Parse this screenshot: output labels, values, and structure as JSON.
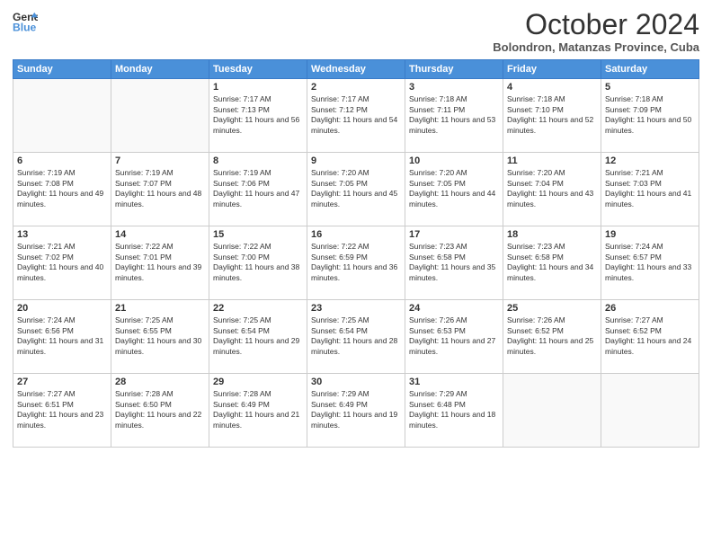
{
  "logo": {
    "line1": "General",
    "line2": "Blue"
  },
  "title": "October 2024",
  "subtitle": "Bolondron, Matanzas Province, Cuba",
  "days_of_week": [
    "Sunday",
    "Monday",
    "Tuesday",
    "Wednesday",
    "Thursday",
    "Friday",
    "Saturday"
  ],
  "weeks": [
    [
      {
        "day": "",
        "sunrise": "",
        "sunset": "",
        "daylight": ""
      },
      {
        "day": "",
        "sunrise": "",
        "sunset": "",
        "daylight": ""
      },
      {
        "day": "1",
        "sunrise": "Sunrise: 7:17 AM",
        "sunset": "Sunset: 7:13 PM",
        "daylight": "Daylight: 11 hours and 56 minutes."
      },
      {
        "day": "2",
        "sunrise": "Sunrise: 7:17 AM",
        "sunset": "Sunset: 7:12 PM",
        "daylight": "Daylight: 11 hours and 54 minutes."
      },
      {
        "day": "3",
        "sunrise": "Sunrise: 7:18 AM",
        "sunset": "Sunset: 7:11 PM",
        "daylight": "Daylight: 11 hours and 53 minutes."
      },
      {
        "day": "4",
        "sunrise": "Sunrise: 7:18 AM",
        "sunset": "Sunset: 7:10 PM",
        "daylight": "Daylight: 11 hours and 52 minutes."
      },
      {
        "day": "5",
        "sunrise": "Sunrise: 7:18 AM",
        "sunset": "Sunset: 7:09 PM",
        "daylight": "Daylight: 11 hours and 50 minutes."
      }
    ],
    [
      {
        "day": "6",
        "sunrise": "Sunrise: 7:19 AM",
        "sunset": "Sunset: 7:08 PM",
        "daylight": "Daylight: 11 hours and 49 minutes."
      },
      {
        "day": "7",
        "sunrise": "Sunrise: 7:19 AM",
        "sunset": "Sunset: 7:07 PM",
        "daylight": "Daylight: 11 hours and 48 minutes."
      },
      {
        "day": "8",
        "sunrise": "Sunrise: 7:19 AM",
        "sunset": "Sunset: 7:06 PM",
        "daylight": "Daylight: 11 hours and 47 minutes."
      },
      {
        "day": "9",
        "sunrise": "Sunrise: 7:20 AM",
        "sunset": "Sunset: 7:05 PM",
        "daylight": "Daylight: 11 hours and 45 minutes."
      },
      {
        "day": "10",
        "sunrise": "Sunrise: 7:20 AM",
        "sunset": "Sunset: 7:05 PM",
        "daylight": "Daylight: 11 hours and 44 minutes."
      },
      {
        "day": "11",
        "sunrise": "Sunrise: 7:20 AM",
        "sunset": "Sunset: 7:04 PM",
        "daylight": "Daylight: 11 hours and 43 minutes."
      },
      {
        "day": "12",
        "sunrise": "Sunrise: 7:21 AM",
        "sunset": "Sunset: 7:03 PM",
        "daylight": "Daylight: 11 hours and 41 minutes."
      }
    ],
    [
      {
        "day": "13",
        "sunrise": "Sunrise: 7:21 AM",
        "sunset": "Sunset: 7:02 PM",
        "daylight": "Daylight: 11 hours and 40 minutes."
      },
      {
        "day": "14",
        "sunrise": "Sunrise: 7:22 AM",
        "sunset": "Sunset: 7:01 PM",
        "daylight": "Daylight: 11 hours and 39 minutes."
      },
      {
        "day": "15",
        "sunrise": "Sunrise: 7:22 AM",
        "sunset": "Sunset: 7:00 PM",
        "daylight": "Daylight: 11 hours and 38 minutes."
      },
      {
        "day": "16",
        "sunrise": "Sunrise: 7:22 AM",
        "sunset": "Sunset: 6:59 PM",
        "daylight": "Daylight: 11 hours and 36 minutes."
      },
      {
        "day": "17",
        "sunrise": "Sunrise: 7:23 AM",
        "sunset": "Sunset: 6:58 PM",
        "daylight": "Daylight: 11 hours and 35 minutes."
      },
      {
        "day": "18",
        "sunrise": "Sunrise: 7:23 AM",
        "sunset": "Sunset: 6:58 PM",
        "daylight": "Daylight: 11 hours and 34 minutes."
      },
      {
        "day": "19",
        "sunrise": "Sunrise: 7:24 AM",
        "sunset": "Sunset: 6:57 PM",
        "daylight": "Daylight: 11 hours and 33 minutes."
      }
    ],
    [
      {
        "day": "20",
        "sunrise": "Sunrise: 7:24 AM",
        "sunset": "Sunset: 6:56 PM",
        "daylight": "Daylight: 11 hours and 31 minutes."
      },
      {
        "day": "21",
        "sunrise": "Sunrise: 7:25 AM",
        "sunset": "Sunset: 6:55 PM",
        "daylight": "Daylight: 11 hours and 30 minutes."
      },
      {
        "day": "22",
        "sunrise": "Sunrise: 7:25 AM",
        "sunset": "Sunset: 6:54 PM",
        "daylight": "Daylight: 11 hours and 29 minutes."
      },
      {
        "day": "23",
        "sunrise": "Sunrise: 7:25 AM",
        "sunset": "Sunset: 6:54 PM",
        "daylight": "Daylight: 11 hours and 28 minutes."
      },
      {
        "day": "24",
        "sunrise": "Sunrise: 7:26 AM",
        "sunset": "Sunset: 6:53 PM",
        "daylight": "Daylight: 11 hours and 27 minutes."
      },
      {
        "day": "25",
        "sunrise": "Sunrise: 7:26 AM",
        "sunset": "Sunset: 6:52 PM",
        "daylight": "Daylight: 11 hours and 25 minutes."
      },
      {
        "day": "26",
        "sunrise": "Sunrise: 7:27 AM",
        "sunset": "Sunset: 6:52 PM",
        "daylight": "Daylight: 11 hours and 24 minutes."
      }
    ],
    [
      {
        "day": "27",
        "sunrise": "Sunrise: 7:27 AM",
        "sunset": "Sunset: 6:51 PM",
        "daylight": "Daylight: 11 hours and 23 minutes."
      },
      {
        "day": "28",
        "sunrise": "Sunrise: 7:28 AM",
        "sunset": "Sunset: 6:50 PM",
        "daylight": "Daylight: 11 hours and 22 minutes."
      },
      {
        "day": "29",
        "sunrise": "Sunrise: 7:28 AM",
        "sunset": "Sunset: 6:49 PM",
        "daylight": "Daylight: 11 hours and 21 minutes."
      },
      {
        "day": "30",
        "sunrise": "Sunrise: 7:29 AM",
        "sunset": "Sunset: 6:49 PM",
        "daylight": "Daylight: 11 hours and 19 minutes."
      },
      {
        "day": "31",
        "sunrise": "Sunrise: 7:29 AM",
        "sunset": "Sunset: 6:48 PM",
        "daylight": "Daylight: 11 hours and 18 minutes."
      },
      {
        "day": "",
        "sunrise": "",
        "sunset": "",
        "daylight": ""
      },
      {
        "day": "",
        "sunrise": "",
        "sunset": "",
        "daylight": ""
      }
    ]
  ]
}
